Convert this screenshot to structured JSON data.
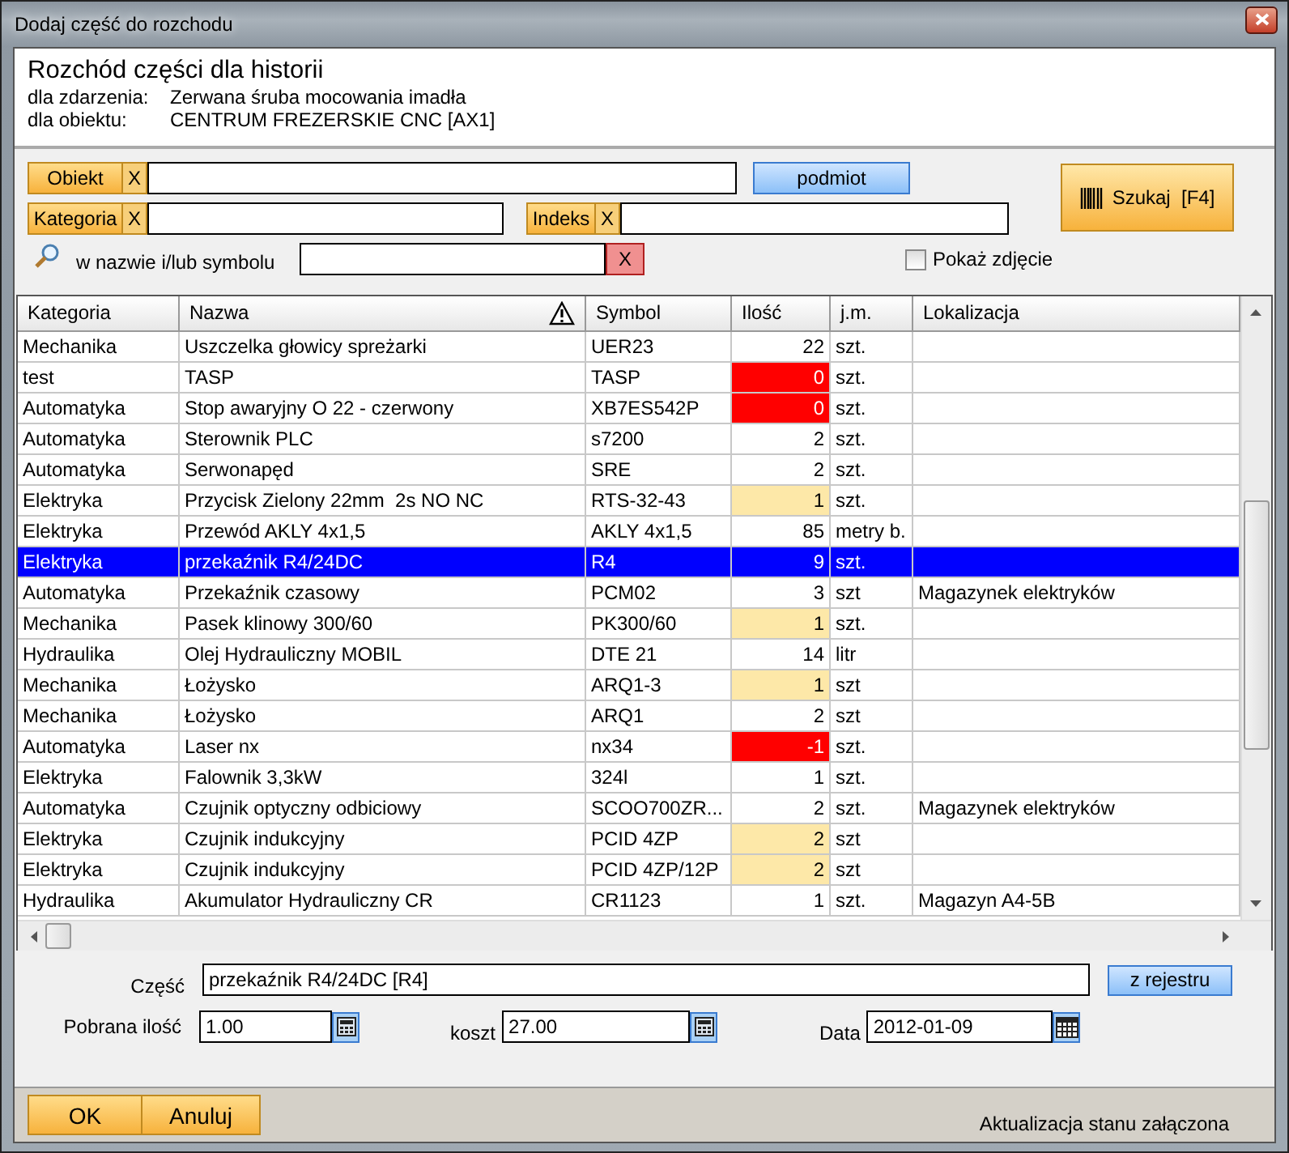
{
  "window": {
    "title": "Dodaj część do rozchodu"
  },
  "header": {
    "title": "Rozchód części dla historii",
    "details": [
      {
        "label": "dla zdarzenia:",
        "value": "Zerwana śruba mocowania imadła"
      },
      {
        "label": "dla obiektu:",
        "value": "CENTRUM FREZERSKIE CNC [AX1]"
      }
    ]
  },
  "filters": {
    "object": {
      "label": "Obiekt",
      "clear": "X"
    },
    "subject_button": "podmiot",
    "category": {
      "label": "Kategoria",
      "clear": "X"
    },
    "index": {
      "label": "Indeks",
      "clear": "X"
    },
    "name_search": {
      "label": "w nazwie i/lub symbolu",
      "clear": "X"
    },
    "show_photo": {
      "label": "Pokaż zdjęcie",
      "checked": false
    },
    "search_button": "Szukaj  [F4]"
  },
  "table": {
    "columns": [
      "Kategoria",
      "Nazwa",
      "Symbol",
      "Ilość",
      "j.m.",
      "Lokalizacja"
    ],
    "rows": [
      {
        "category": "Mechanika",
        "name": "Uszczelka głowicy spreżarki",
        "symbol": "UER23",
        "quantity": "22",
        "unit": "szt.",
        "location": "",
        "color": "#ffffff",
        "selected": false
      },
      {
        "category": "test",
        "name": "TASP",
        "symbol": "TASP",
        "quantity": "0",
        "unit": "szt.",
        "location": "",
        "color": "#ff0000",
        "selected": false
      },
      {
        "category": "Automatyka",
        "name": "Stop awaryjny O 22 - czerwony",
        "symbol": "XB7ES542P",
        "quantity": "0",
        "unit": "szt.",
        "location": "",
        "color": "#ff0000",
        "selected": false
      },
      {
        "category": "Automatyka",
        "name": "Sterownik PLC",
        "symbol": "s7200",
        "quantity": "2",
        "unit": "szt.",
        "location": "",
        "color": "#ffffff",
        "selected": false
      },
      {
        "category": "Automatyka",
        "name": "Serwonapęd",
        "symbol": "SRE",
        "quantity": "2",
        "unit": "szt.",
        "location": "",
        "color": "#ffffff",
        "selected": false
      },
      {
        "category": "Elektryka",
        "name": "Przycisk Zielony 22mm  2s NO NC",
        "symbol": "RTS-32-43",
        "quantity": "1",
        "unit": "szt.",
        "location": "",
        "color": "#fde8a8",
        "selected": false
      },
      {
        "category": "Elektryka",
        "name": "Przewód AKLY 4x1,5",
        "symbol": "AKLY 4x1,5",
        "quantity": "85",
        "unit": "metry b.",
        "location": "",
        "color": "#ffffff",
        "selected": false
      },
      {
        "category": "Elektryka",
        "name": "przekaźnik R4/24DC",
        "symbol": "R4",
        "quantity": "9",
        "unit": "szt.",
        "location": "",
        "selected": true
      },
      {
        "category": "Automatyka",
        "name": "Przekaźnik czasowy",
        "symbol": "PCM02",
        "quantity": "3",
        "unit": "szt",
        "location": "Magazynek elektryków",
        "color": "#ffffff",
        "selected": false
      },
      {
        "category": "Mechanika",
        "name": "Pasek klinowy 300/60",
        "symbol": "PK300/60",
        "quantity": "1",
        "unit": "szt.",
        "location": "",
        "color": "#fde8a8",
        "selected": false
      },
      {
        "category": "Hydraulika",
        "name": "Olej Hydrauliczny MOBIL",
        "symbol": "DTE 21",
        "quantity": "14",
        "unit": "litr",
        "location": "",
        "color": "#ffffff",
        "selected": false
      },
      {
        "category": "Mechanika",
        "name": "Łożysko",
        "symbol": "ARQ1-3",
        "quantity": "1",
        "unit": "szt",
        "location": "",
        "color": "#fde8a8",
        "selected": false
      },
      {
        "category": "Mechanika",
        "name": "Łożysko",
        "symbol": "ARQ1",
        "quantity": "2",
        "unit": "szt",
        "location": "",
        "color": "#ffffff",
        "selected": false
      },
      {
        "category": "Automatyka",
        "name": "Laser nx",
        "symbol": "nx34",
        "quantity": "-1",
        "unit": "szt.",
        "location": "",
        "color": "#ff0000",
        "selected": false
      },
      {
        "category": "Elektryka",
        "name": "Falownik 3,3kW",
        "symbol": "324l",
        "quantity": "1",
        "unit": "szt.",
        "location": "",
        "color": "#ffffff",
        "selected": false
      },
      {
        "category": "Automatyka",
        "name": "Czujnik optyczny odbiciowy",
        "symbol": "SCOO700ZR...",
        "quantity": "2",
        "unit": "szt.",
        "location": "Magazynek elektryków",
        "color": "#ffffff",
        "selected": false
      },
      {
        "category": "Elektryka",
        "name": "Czujnik indukcyjny",
        "symbol": "PCID 4ZP",
        "quantity": "2",
        "unit": "szt",
        "location": "",
        "color": "#fde8a8",
        "selected": false
      },
      {
        "category": "Elektryka",
        "name": "Czujnik indukcyjny",
        "symbol": "PCID 4ZP/12P",
        "quantity": "2",
        "unit": "szt",
        "location": "",
        "color": "#fde8a8",
        "selected": false
      },
      {
        "category": "Hydraulika",
        "name": "Akumulator Hydrauliczny CR",
        "symbol": "CR1123",
        "quantity": "1",
        "unit": "szt.",
        "location": "Magazyn A4-5B",
        "color": "#ffffff",
        "selected": false
      }
    ]
  },
  "form": {
    "part": {
      "label": "Część",
      "value": "przekaźnik R4/24DC [R4]"
    },
    "registry_button": "z rejestru",
    "quantity": {
      "label": "Pobrana ilość",
      "value": "1.00"
    },
    "cost": {
      "label": "koszt",
      "value": "27.00"
    },
    "date": {
      "label": "Data",
      "value": "2012-01-09"
    }
  },
  "footer": {
    "buttons": [
      "OK",
      "Anuluj"
    ],
    "status": "Aktualizacja stanu załączona"
  }
}
